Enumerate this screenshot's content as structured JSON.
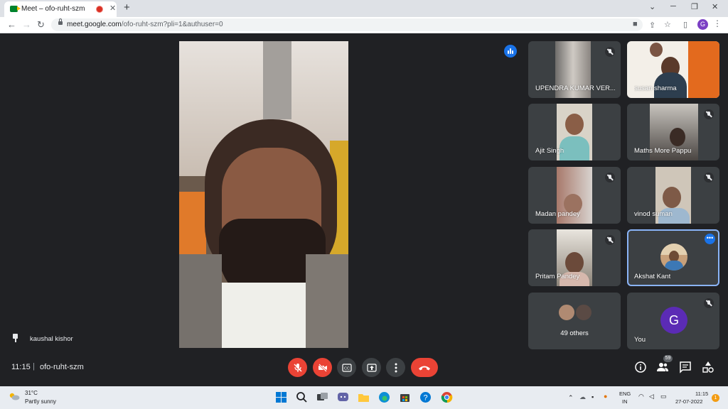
{
  "browser": {
    "tab_title": "Meet – ofo-ruht-szm",
    "tab_close": "✕",
    "new_tab": "+",
    "url_host": "meet.google.com",
    "url_path": "/ofo-ruht-szm?pli=1&authuser=0",
    "profile_initial": "G",
    "window_controls": [
      "⌄",
      "─",
      "❐",
      "✕"
    ]
  },
  "meeting": {
    "pinned_name": "kaushal kishor",
    "time": "11:15",
    "separator": "|",
    "code": "ofo-ruht-szm",
    "participants_count": "59"
  },
  "tiles": [
    {
      "name": "UPENDRA KUMAR VER...",
      "muted": true
    },
    {
      "name": "susan sharma",
      "muted": false
    },
    {
      "name": "Ajit Singh",
      "muted": false
    },
    {
      "name": "Maths More Pappu",
      "muted": true
    },
    {
      "name": "Madan pandey",
      "muted": true
    },
    {
      "name": "vinod suman",
      "muted": true
    },
    {
      "name": "Pritam Pandey",
      "muted": true
    },
    {
      "name": "Akshat Kant",
      "muted": false
    },
    {
      "name": "49 others",
      "muted": false
    },
    {
      "name": "You",
      "muted": true
    }
  ],
  "you_avatar_initial": "G",
  "more_dots": "•••",
  "taskbar": {
    "temp": "31°C",
    "weather": "Partly sunny",
    "lang": "ENG",
    "region": "IN",
    "clock_time": "11:15",
    "clock_date": "27-07-2022",
    "notifications": "1"
  },
  "colors": {
    "end_call": "#ea4335",
    "speaking": "#1a73e8",
    "tile_bg": "#3c4043",
    "bg": "#202124"
  }
}
